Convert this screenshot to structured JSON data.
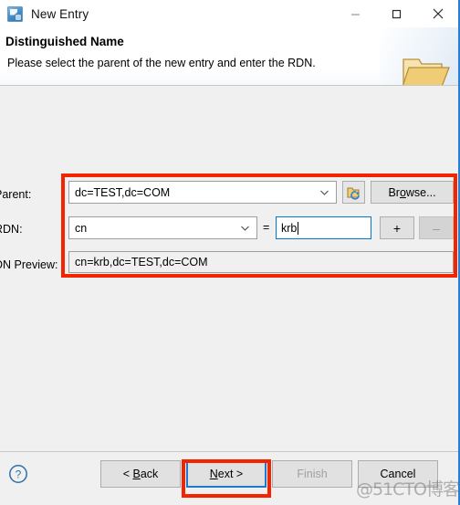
{
  "window": {
    "title": "New Entry",
    "icon": "app-icon",
    "controls": {
      "minimize": "minimize",
      "maximize": "maximize",
      "close": "close"
    }
  },
  "header": {
    "title": "Distinguished Name",
    "description": "Please select the parent of the new entry and enter the RDN.",
    "icon": "folder-icon"
  },
  "form": {
    "parent": {
      "label": "Parent:",
      "value": "dc=TEST,dc=COM",
      "refresh_icon": "refresh-folder-icon",
      "browse_label": "Browse..."
    },
    "rdn": {
      "label": "RDN:",
      "attribute": "cn",
      "equals": "=",
      "value": "krb",
      "add_label": "+",
      "remove_label": "–"
    },
    "dn_preview": {
      "label": "DN Preview:",
      "value": "cn=krb,dc=TEST,dc=COM"
    }
  },
  "footer": {
    "help_icon": "help-icon",
    "buttons": {
      "back": "< Back",
      "next": "Next >",
      "finish": "Finish",
      "cancel": "Cancel"
    }
  },
  "annotations": {
    "highlight_color": "#f52400",
    "focus_color": "#0078d7",
    "watermark": "@51CTO博客"
  }
}
